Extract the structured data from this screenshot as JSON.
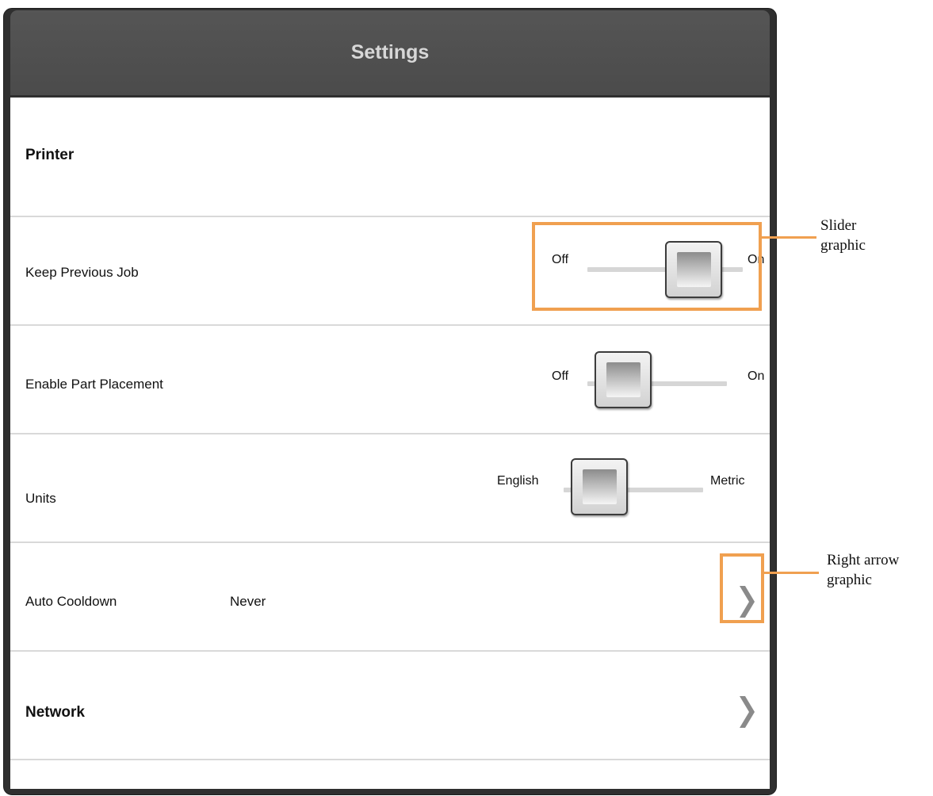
{
  "header": {
    "title": "Settings"
  },
  "printer": {
    "section_label": "Printer"
  },
  "keep_previous_job": {
    "label": "Keep Previous Job",
    "off_label": "Off",
    "on_label": "On",
    "state": "On"
  },
  "enable_part_placement": {
    "label": "Enable Part Placement",
    "off_label": "Off",
    "on_label": "On",
    "state": "Off"
  },
  "units": {
    "label": "Units",
    "left_label": "English",
    "right_label": "Metric",
    "state": "English"
  },
  "auto_cooldown": {
    "label": "Auto Cooldown",
    "value": "Never",
    "icon": "chevron-right-icon"
  },
  "network": {
    "section_label": "Network",
    "icon": "chevron-right-icon"
  },
  "callouts": {
    "slider": {
      "line1": "Slider",
      "line2": "graphic"
    },
    "arrow": {
      "line1": "Right arrow",
      "line2": "graphic"
    }
  },
  "colors": {
    "header_bg": "#4b4b4b",
    "header_text": "#d7d7d7",
    "callout": "#f0a050",
    "divider": "#d9d9d9"
  }
}
